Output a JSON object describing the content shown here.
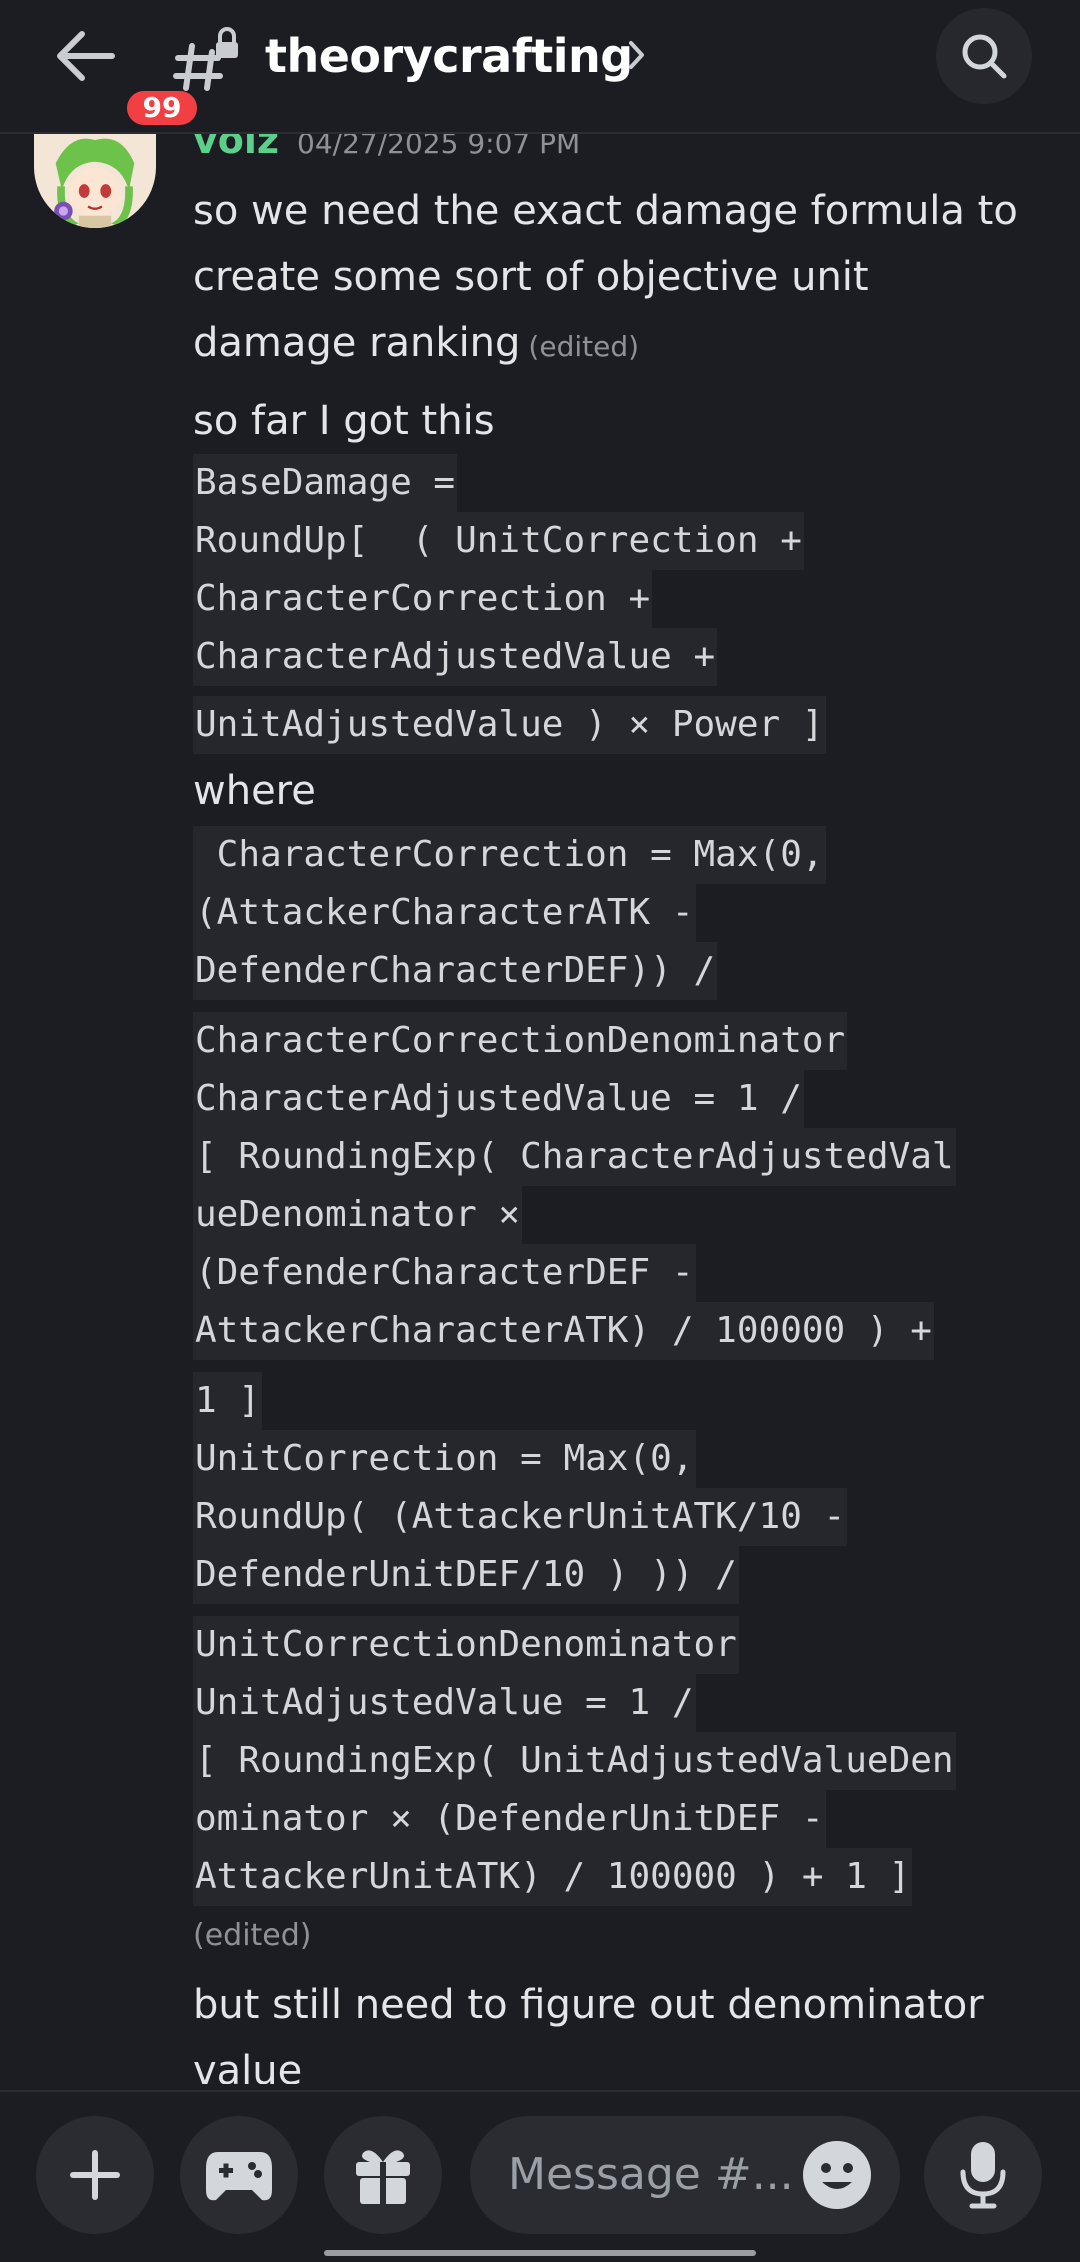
{
  "header": {
    "unread_badge": "99",
    "channel_name": "theorycrafting",
    "back_icon": "arrow-left-icon",
    "channel_icon": "hashtag-lock-icon",
    "chevron_icon": "chevron-right-icon",
    "search_icon": "search-icon"
  },
  "message": {
    "author": "voiz",
    "timestamp": "04/27/2025 9:07 PM",
    "author_color": "#5bd08a",
    "paragraph1_lines": [
      "so we need the exact damage formula to",
      "create some sort of objective  unit",
      "damage ranking"
    ],
    "edited_label": "(edited)",
    "paragraph2": "so far I got this",
    "code1_lines": [
      "BaseDamage =",
      "RoundUp[  ( UnitCorrection +",
      "CharacterCorrection +",
      "CharacterAdjustedValue +",
      "UnitAdjustedValue ) × Power ]"
    ],
    "where_label": "where",
    "code2_lines": [
      " CharacterCorrection = Max(0,",
      "(AttackerCharacterATK -",
      "DefenderCharacterDEF)) /",
      "CharacterCorrectionDenominator",
      "CharacterAdjustedValue = 1 /",
      "[ RoundingExp( CharacterAdjustedVal",
      "ueDenominator ×",
      "(DefenderCharacterDEF -",
      "AttackerCharacterATK) / 100000 ) +",
      "1 ]",
      "UnitCorrection = Max(0,",
      "RoundUp( (AttackerUnitATK/10 -",
      "DefenderUnitDEF/10 ) )) /",
      "UnitCorrectionDenominator",
      "UnitAdjustedValue = 1 /",
      "[ RoundingExp( UnitAdjustedValueDen",
      "ominator × (DefenderUnitDEF -",
      "AttackerUnitATK) / 100000 ) + 1 ]"
    ],
    "edited_label2": "(edited)",
    "paragraph3_lines": [
      "but still need to figure out denominator",
      "value"
    ]
  },
  "composer": {
    "placeholder": "Message #...",
    "add_icon": "plus-icon",
    "game_icon": "gamepad-icon",
    "gift_icon": "gift-icon",
    "emoji_icon": "emoji-icon",
    "mic_icon": "microphone-icon"
  }
}
